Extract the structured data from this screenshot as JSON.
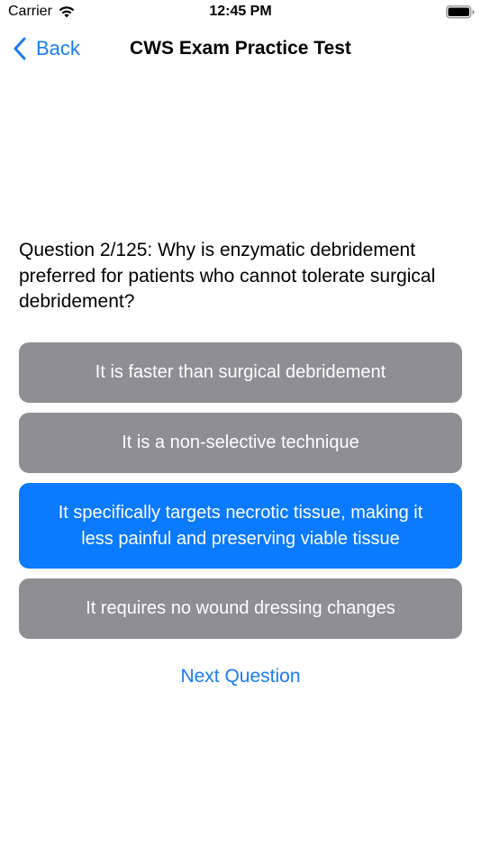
{
  "status_bar": {
    "carrier": "Carrier",
    "time": "12:45 PM",
    "wifi_icon": "wifi-icon",
    "battery_icon": "battery-icon"
  },
  "nav": {
    "back_label": "Back",
    "back_icon": "chevron-left-icon",
    "title": "CWS Exam Practice Test"
  },
  "question": {
    "text": "Question 2/125: Why is enzymatic debridement preferred for patients who cannot tolerate surgical debridement?"
  },
  "answers": [
    {
      "label": "It is faster than surgical debridement",
      "selected": false
    },
    {
      "label": "It is a non-selective technique",
      "selected": false
    },
    {
      "label": "It specifically targets necrotic tissue, making it less painful and preserving viable tissue",
      "selected": true
    },
    {
      "label": "It requires no wound dressing changes",
      "selected": false
    }
  ],
  "next_label": "Next Question",
  "colors": {
    "accent": "#0a7aff",
    "answer_default": "#8e8e93",
    "answer_text": "#ffffff"
  }
}
